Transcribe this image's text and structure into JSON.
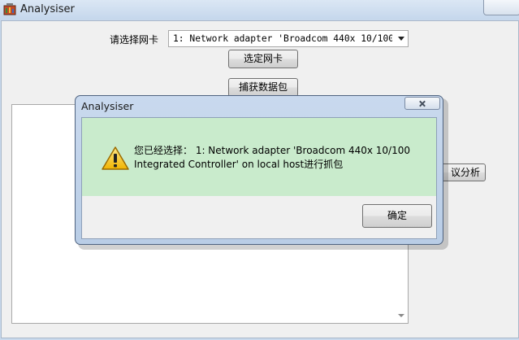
{
  "main_window": {
    "title": "Analysiser",
    "nic_label": "请选择网卡",
    "nic_selected": "1: Network adapter 'Broadcom 440x 10/100 Integrated Controller' on local host",
    "select_nic_button": "选定网卡",
    "capture_button": "捕获数据包",
    "analyze_button_visible": "议分析"
  },
  "dialog": {
    "title": "Analysiser",
    "message": "您已经选择： 1: Network adapter 'Broadcom 440x 10/100\nIntegrated Controller' on local host进行抓包",
    "ok_button": "确定",
    "icon": "warning-icon"
  },
  "colors": {
    "message_background": "#c9ebcc",
    "title_bar": "#c9d9ec"
  }
}
